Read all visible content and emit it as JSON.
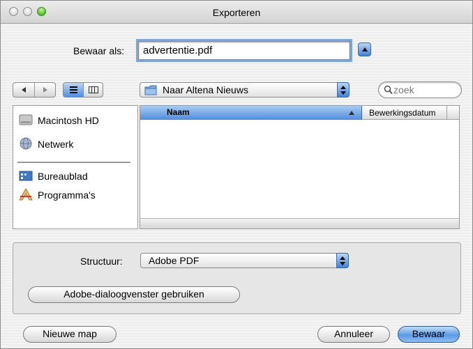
{
  "window": {
    "title": "Exporteren"
  },
  "save": {
    "label": "Bewaar als:",
    "filename": "advertentie.pdf"
  },
  "location": {
    "folder": "Naar Altena Nieuws"
  },
  "search": {
    "placeholder": "zoek"
  },
  "sidebar": {
    "items": [
      {
        "label": "Macintosh HD",
        "icon": "hard-drive-icon"
      },
      {
        "label": "Netwerk",
        "icon": "network-globe-icon"
      },
      {
        "label": "Bureaublad",
        "icon": "desktop-icon"
      },
      {
        "label": "Programma's",
        "icon": "applications-icon"
      }
    ]
  },
  "filelist": {
    "columns": [
      "Naam",
      "Bewerkingsdatum"
    ],
    "sort_column": "Naam",
    "sort_direction": "ascending"
  },
  "options": {
    "structure_label": "Structuur:",
    "structure_value": "Adobe PDF",
    "adobe_dialog_button": "Adobe-dialoogvenster gebruiken"
  },
  "buttons": {
    "new_folder": "Nieuwe map",
    "cancel": "Annuleer",
    "save": "Bewaar"
  },
  "colors": {
    "accent": "#3f84d8",
    "selection_header": "#5a95e0"
  }
}
